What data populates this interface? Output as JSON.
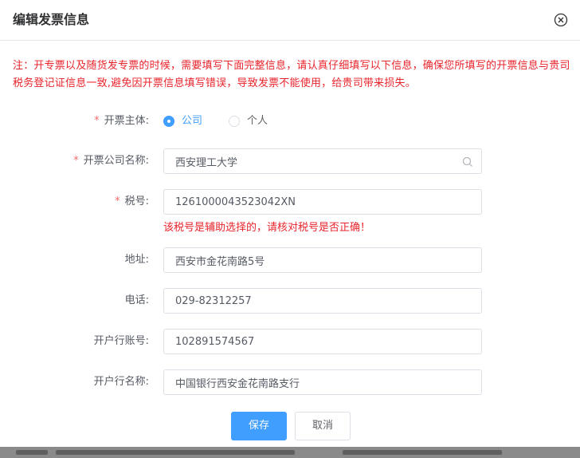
{
  "dialog": {
    "title": "编辑发票信息",
    "close_icon": "close-circle-icon"
  },
  "notice": "注：开专票以及随货发专票的时候，需要填写下面完整信息，请认真仔细填写以下信息，确保您所填写的开票信息与贵司税务登记证信息一致,避免因开票信息填写错误，导致发票不能使用，给贵司带来损失。",
  "form": {
    "required_mark": "*",
    "subject": {
      "label": "开票主体:",
      "options": [
        "公司",
        "个人"
      ],
      "selected": "公司"
    },
    "company_name": {
      "label": "开票公司名称:",
      "value": "西安理工大学",
      "icon": "search-icon"
    },
    "tax_id": {
      "label": "税号:",
      "value": "1261000043523042XN",
      "error": "该税号是辅助选择的，请核对税号是否正确！"
    },
    "address": {
      "label": "地址:",
      "value": "西安市金花南路5号"
    },
    "phone": {
      "label": "电话:",
      "value": "029-82312257"
    },
    "bank_account": {
      "label": "开户行账号:",
      "value": "102891574567"
    },
    "bank_name": {
      "label": "开户行名称:",
      "value": "中国银行西安金花南路支行"
    }
  },
  "buttons": {
    "save": "保存",
    "cancel": "取消"
  },
  "colors": {
    "primary": "#409eff",
    "error": "#e8242c",
    "required": "#f56c6c"
  }
}
